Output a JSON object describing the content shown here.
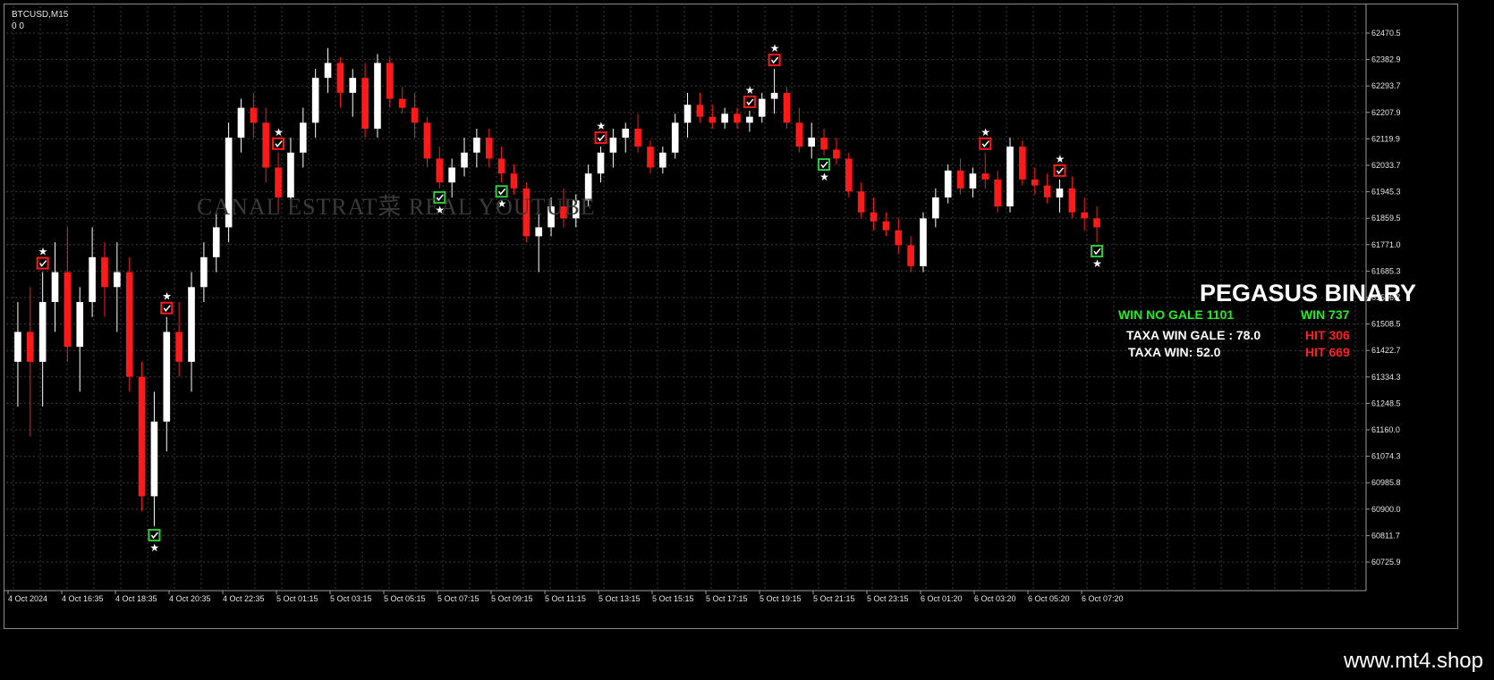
{
  "symbol": "BTCUSD,M15",
  "symbol_sub": "0 0",
  "watermark": "CANAL ESTRAT菜 REAL YOUTUBE",
  "panel": {
    "title": "PEGASUS BINARY",
    "win_no_gale": "WIN NO GALE  1101",
    "win": "WIN  737",
    "taxa_win_gale": "TAXA WIN GALE : 78.0",
    "hit1": "HIT  306",
    "taxa_win": "TAXA WIN: 52.0",
    "hit2": "HIT  669"
  },
  "site": "www.mt4.shop",
  "colors": {
    "bull": "#ffffff",
    "bear": "#ff1a1a",
    "grid": "#3c3c3c",
    "signal_box": "#2ecc40",
    "signal_red": "#ff1a1a",
    "panel_green": "#22ee22",
    "panel_red": "#ff2020"
  },
  "price_axis": [
    "62470.5",
    "62382.9",
    "62293.7",
    "62207.9",
    "62119.9",
    "62033.7",
    "61945.3",
    "61859.5",
    "61771.0",
    "61685.3",
    "61596.7",
    "61508.5",
    "61422.7",
    "61334.3",
    "61248.5",
    "61160.0",
    "61074.3",
    "60985.8",
    "60900.0",
    "60811.7",
    "60725.9"
  ],
  "time_axis": [
    "4 Oct 2024",
    "4 Oct 16:35",
    "4 Oct 18:35",
    "4 Oct 20:35",
    "4 Oct 22:35",
    "5 Oct 01:15",
    "5 Oct 03:15",
    "5 Oct 05:15",
    "5 Oct 07:15",
    "5 Oct 09:15",
    "5 Oct 11:15",
    "5 Oct 13:15",
    "5 Oct 15:15",
    "5 Oct 17:15",
    "5 Oct 19:15",
    "5 Oct 21:15",
    "5 Oct 23:15",
    "6 Oct 01:20",
    "6 Oct 03:20",
    "6 Oct 05:20",
    "6 Oct 07:20"
  ],
  "chart_data": {
    "type": "candlestick",
    "y_range": [
      60700,
      62500
    ],
    "candles": [
      [
        61400,
        61600,
        61250,
        61500
      ],
      [
        61500,
        61650,
        61150,
        61400
      ],
      [
        61400,
        61700,
        61250,
        61600
      ],
      [
        61600,
        61800,
        61500,
        61700
      ],
      [
        61700,
        61850,
        61400,
        61450
      ],
      [
        61450,
        61650,
        61300,
        61600
      ],
      [
        61600,
        61850,
        61550,
        61750
      ],
      [
        61750,
        61800,
        61550,
        61650
      ],
      [
        61650,
        61800,
        61500,
        61700
      ],
      [
        61700,
        61750,
        61300,
        61350
      ],
      [
        61350,
        61400,
        60900,
        60950
      ],
      [
        60950,
        61300,
        60850,
        61200
      ],
      [
        61200,
        61550,
        61100,
        61500
      ],
      [
        61500,
        61600,
        61350,
        61400
      ],
      [
        61400,
        61700,
        61300,
        61650
      ],
      [
        61650,
        61800,
        61600,
        61750
      ],
      [
        61750,
        61900,
        61700,
        61850
      ],
      [
        61850,
        62200,
        61800,
        62150
      ],
      [
        62150,
        62280,
        62100,
        62250
      ],
      [
        62250,
        62300,
        62150,
        62200
      ],
      [
        62200,
        62250,
        62000,
        62050
      ],
      [
        62050,
        62100,
        61900,
        61950
      ],
      [
        61950,
        62150,
        61900,
        62100
      ],
      [
        62100,
        62250,
        62050,
        62200
      ],
      [
        62200,
        62380,
        62150,
        62350
      ],
      [
        62350,
        62450,
        62300,
        62400
      ],
      [
        62400,
        62420,
        62250,
        62300
      ],
      [
        62300,
        62380,
        62220,
        62350
      ],
      [
        62350,
        62400,
        62150,
        62180
      ],
      [
        62180,
        62430,
        62150,
        62400
      ],
      [
        62400,
        62420,
        62250,
        62280
      ],
      [
        62280,
        62320,
        62230,
        62250
      ],
      [
        62250,
        62300,
        62150,
        62200
      ],
      [
        62200,
        62220,
        62050,
        62080
      ],
      [
        62080,
        62120,
        61980,
        62000
      ],
      [
        62000,
        62080,
        61950,
        62050
      ],
      [
        62050,
        62150,
        62020,
        62100
      ],
      [
        62100,
        62180,
        62050,
        62150
      ],
      [
        62150,
        62180,
        62050,
        62080
      ],
      [
        62080,
        62120,
        62000,
        62030
      ],
      [
        62030,
        62060,
        61960,
        61980
      ],
      [
        61980,
        62000,
        61800,
        61820
      ],
      [
        61820,
        61900,
        61700,
        61850
      ],
      [
        61850,
        61950,
        61820,
        61920
      ],
      [
        61920,
        61980,
        61850,
        61880
      ],
      [
        61880,
        61960,
        61850,
        61940
      ],
      [
        61940,
        62060,
        61920,
        62030
      ],
      [
        62030,
        62120,
        62000,
        62100
      ],
      [
        62100,
        62180,
        62050,
        62150
      ],
      [
        62150,
        62200,
        62100,
        62180
      ],
      [
        62180,
        62230,
        62100,
        62120
      ],
      [
        62120,
        62140,
        62030,
        62050
      ],
      [
        62050,
        62120,
        62030,
        62100
      ],
      [
        62100,
        62230,
        62080,
        62200
      ],
      [
        62200,
        62300,
        62150,
        62260
      ],
      [
        62260,
        62300,
        62200,
        62220
      ],
      [
        62220,
        62260,
        62180,
        62200
      ],
      [
        62200,
        62250,
        62180,
        62230
      ],
      [
        62230,
        62250,
        62180,
        62200
      ],
      [
        62200,
        62240,
        62170,
        62220
      ],
      [
        62220,
        62300,
        62200,
        62280
      ],
      [
        62280,
        62380,
        62230,
        62300
      ],
      [
        62300,
        62320,
        62180,
        62200
      ],
      [
        62200,
        62250,
        62100,
        62120
      ],
      [
        62120,
        62200,
        62080,
        62150
      ],
      [
        62150,
        62180,
        62090,
        62110
      ],
      [
        62110,
        62150,
        62060,
        62080
      ],
      [
        62080,
        62100,
        61950,
        61970
      ],
      [
        61970,
        62000,
        61880,
        61900
      ],
      [
        61900,
        61950,
        61840,
        61870
      ],
      [
        61870,
        61900,
        61820,
        61840
      ],
      [
        61840,
        61880,
        61760,
        61790
      ],
      [
        61790,
        61820,
        61700,
        61720
      ],
      [
        61720,
        61900,
        61700,
        61880
      ],
      [
        61880,
        61980,
        61850,
        61950
      ],
      [
        61950,
        62060,
        61930,
        62040
      ],
      [
        62040,
        62080,
        61960,
        61980
      ],
      [
        61980,
        62050,
        61950,
        62030
      ],
      [
        62030,
        62100,
        61980,
        62010
      ],
      [
        62010,
        62040,
        61900,
        61920
      ],
      [
        61920,
        62150,
        61900,
        62120
      ],
      [
        62120,
        62140,
        61990,
        62010
      ],
      [
        62010,
        62050,
        61960,
        61990
      ],
      [
        61990,
        62030,
        61930,
        61950
      ],
      [
        61950,
        62010,
        61900,
        61980
      ],
      [
        61980,
        62020,
        61880,
        61900
      ],
      [
        61900,
        61950,
        61840,
        61880
      ],
      [
        61880,
        61920,
        61800,
        61850
      ]
    ],
    "signals": [
      {
        "i": 2,
        "kind": "box",
        "color": "red"
      },
      {
        "i": 11,
        "kind": "box",
        "color": "green"
      },
      {
        "i": 12,
        "kind": "box",
        "color": "red"
      },
      {
        "i": 21,
        "kind": "box",
        "color": "red"
      },
      {
        "i": 34,
        "kind": "box",
        "color": "green"
      },
      {
        "i": 39,
        "kind": "box",
        "color": "green"
      },
      {
        "i": 47,
        "kind": "box",
        "color": "red"
      },
      {
        "i": 59,
        "kind": "box",
        "color": "red"
      },
      {
        "i": 61,
        "kind": "box",
        "color": "red"
      },
      {
        "i": 65,
        "kind": "box",
        "color": "green"
      },
      {
        "i": 78,
        "kind": "box",
        "color": "red"
      },
      {
        "i": 84,
        "kind": "box",
        "color": "red"
      },
      {
        "i": 87,
        "kind": "box",
        "color": "green"
      }
    ]
  }
}
